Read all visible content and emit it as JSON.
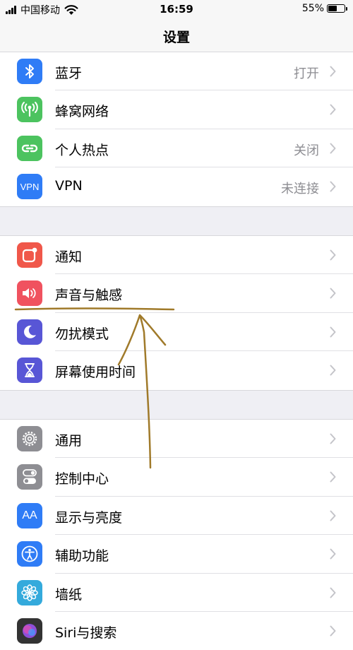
{
  "status_bar": {
    "carrier": "中国移动",
    "time": "16:59",
    "battery_percent": "55%",
    "battery_level": 0.55
  },
  "nav": {
    "title": "设置"
  },
  "groups": [
    {
      "rows": [
        {
          "label": "蓝牙",
          "value": "打开",
          "icon": "bluetooth-icon",
          "color": "#2f7cf6"
        },
        {
          "label": "蜂窝网络",
          "value": "",
          "icon": "cellular-icon",
          "color": "#4cc35f"
        },
        {
          "label": "个人热点",
          "value": "关闭",
          "icon": "hotspot-icon",
          "color": "#4cc35f"
        },
        {
          "label": "VPN",
          "value": "未连接",
          "icon": "vpn-icon",
          "icon_text": "VPN",
          "color": "#2f7cf6"
        }
      ]
    },
    {
      "rows": [
        {
          "label": "通知",
          "value": "",
          "icon": "notifications-icon",
          "color": "#f0574a"
        },
        {
          "label": "声音与触感",
          "value": "",
          "icon": "speaker-icon",
          "color": "#f0525f"
        },
        {
          "label": "勿扰模式",
          "value": "",
          "icon": "moon-icon",
          "color": "#5856d6"
        },
        {
          "label": "屏幕使用时间",
          "value": "",
          "icon": "hourglass-icon",
          "color": "#5856d6"
        }
      ]
    },
    {
      "rows": [
        {
          "label": "通用",
          "value": "",
          "icon": "gear-icon",
          "color": "#8e8e93"
        },
        {
          "label": "控制中心",
          "value": "",
          "icon": "toggles-icon",
          "color": "#8e8e93"
        },
        {
          "label": "显示与亮度",
          "value": "",
          "icon": "text-size-icon",
          "icon_text": "AA",
          "color": "#2f7cf6"
        },
        {
          "label": "辅助功能",
          "value": "",
          "icon": "accessibility-icon",
          "color": "#2f7cf6"
        },
        {
          "label": "墙纸",
          "value": "",
          "icon": "flower-icon",
          "color": "#34aadc"
        },
        {
          "label": "Siri与搜索",
          "value": "",
          "icon": "siri-icon",
          "color": "#333333"
        }
      ]
    }
  ],
  "annotation_color": "#a07a2a"
}
